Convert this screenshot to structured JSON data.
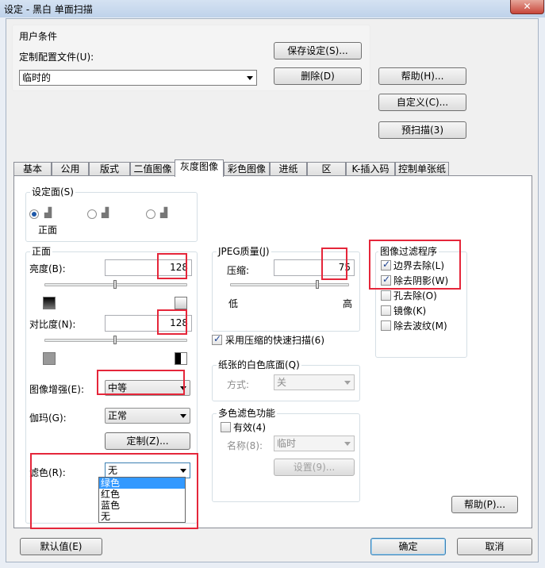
{
  "window": {
    "title": "设定 - 黑白 单面扫描",
    "close_glyph": "✕"
  },
  "user_conditions": {
    "group_title": "用户条件",
    "profile_label": "定制配置文件(U):",
    "profile_value": "临时的",
    "save_button": "保存设定(S)...",
    "delete_button": "删除(D)"
  },
  "right_buttons": {
    "help": "帮助(H)...",
    "customize": "自定义(C)...",
    "prescan": "预扫描(3)"
  },
  "tabs": [
    "基本",
    "公用",
    "版式",
    "二值图像",
    "灰度图像",
    "彩色图像",
    "进纸",
    "区",
    "K-插入码",
    "控制单张纸"
  ],
  "selected_tab": "灰度图像",
  "side": {
    "group_title": "设定面(S)",
    "front_caption": "正面"
  },
  "front": {
    "group_title": "正面",
    "brightness_label": "亮度(B):",
    "brightness_value": "128",
    "contrast_label": "对比度(N):",
    "contrast_value": "128",
    "enhance_label": "图像增强(E):",
    "enhance_value": "中等",
    "gamma_label": "伽玛(G):",
    "gamma_value": "正常",
    "custom_button": "定制(Z)...",
    "filter_label": "滤色(R):",
    "filter_value": "无",
    "filter_options": [
      "绿色",
      "红色",
      "蓝色",
      "无"
    ],
    "filter_highlighted": "绿色"
  },
  "jpeg": {
    "group_title": "JPEG质量(J)",
    "compress_label": "压缩:",
    "compress_value": "75",
    "low_label": "低",
    "high_label": "高"
  },
  "fast_scan": {
    "label": "采用压缩的快速扫描(6)",
    "checked": true
  },
  "paper_white": {
    "group_title": "纸张的白色底面(Q)",
    "mode_label": "方式:",
    "mode_value": "关"
  },
  "multicolor": {
    "group_title": "多色滤色功能",
    "enable_label": "有效(4)",
    "enabled": false,
    "name_label": "名称(8):",
    "name_value": "临时",
    "settings_button": "设置(9)..."
  },
  "image_filter": {
    "group_title": "图像过滤程序",
    "items": [
      {
        "label": "边界去除(L)",
        "checked": true
      },
      {
        "label": "除去阴影(W)",
        "checked": true
      },
      {
        "label": "孔去除(O)",
        "checked": false
      },
      {
        "label": "镜像(K)",
        "checked": false
      },
      {
        "label": "除去波纹(M)",
        "checked": false
      }
    ]
  },
  "panel_help": "帮助(P)...",
  "footer": {
    "default_button": "默认值(E)",
    "ok_button": "确定",
    "cancel_button": "取消"
  },
  "colors": {
    "highlight_red": "#e5263a",
    "selection_blue": "#3399ff",
    "titlebar": "#c4d5ec"
  }
}
